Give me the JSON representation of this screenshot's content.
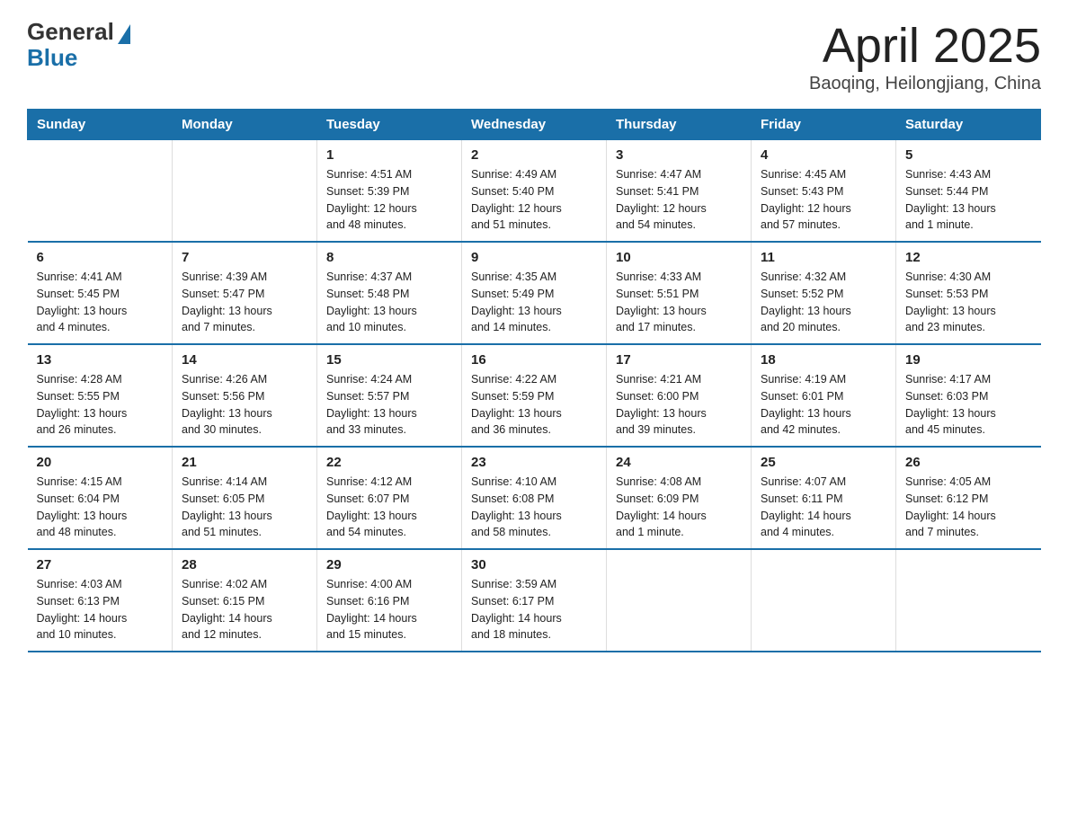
{
  "header": {
    "logo_general": "General",
    "logo_blue": "Blue",
    "title": "April 2025",
    "subtitle": "Baoqing, Heilongjiang, China"
  },
  "calendar": {
    "days_of_week": [
      "Sunday",
      "Monday",
      "Tuesday",
      "Wednesday",
      "Thursday",
      "Friday",
      "Saturday"
    ],
    "weeks": [
      [
        {
          "day": "",
          "info": ""
        },
        {
          "day": "",
          "info": ""
        },
        {
          "day": "1",
          "info": "Sunrise: 4:51 AM\nSunset: 5:39 PM\nDaylight: 12 hours\nand 48 minutes."
        },
        {
          "day": "2",
          "info": "Sunrise: 4:49 AM\nSunset: 5:40 PM\nDaylight: 12 hours\nand 51 minutes."
        },
        {
          "day": "3",
          "info": "Sunrise: 4:47 AM\nSunset: 5:41 PM\nDaylight: 12 hours\nand 54 minutes."
        },
        {
          "day": "4",
          "info": "Sunrise: 4:45 AM\nSunset: 5:43 PM\nDaylight: 12 hours\nand 57 minutes."
        },
        {
          "day": "5",
          "info": "Sunrise: 4:43 AM\nSunset: 5:44 PM\nDaylight: 13 hours\nand 1 minute."
        }
      ],
      [
        {
          "day": "6",
          "info": "Sunrise: 4:41 AM\nSunset: 5:45 PM\nDaylight: 13 hours\nand 4 minutes."
        },
        {
          "day": "7",
          "info": "Sunrise: 4:39 AM\nSunset: 5:47 PM\nDaylight: 13 hours\nand 7 minutes."
        },
        {
          "day": "8",
          "info": "Sunrise: 4:37 AM\nSunset: 5:48 PM\nDaylight: 13 hours\nand 10 minutes."
        },
        {
          "day": "9",
          "info": "Sunrise: 4:35 AM\nSunset: 5:49 PM\nDaylight: 13 hours\nand 14 minutes."
        },
        {
          "day": "10",
          "info": "Sunrise: 4:33 AM\nSunset: 5:51 PM\nDaylight: 13 hours\nand 17 minutes."
        },
        {
          "day": "11",
          "info": "Sunrise: 4:32 AM\nSunset: 5:52 PM\nDaylight: 13 hours\nand 20 minutes."
        },
        {
          "day": "12",
          "info": "Sunrise: 4:30 AM\nSunset: 5:53 PM\nDaylight: 13 hours\nand 23 minutes."
        }
      ],
      [
        {
          "day": "13",
          "info": "Sunrise: 4:28 AM\nSunset: 5:55 PM\nDaylight: 13 hours\nand 26 minutes."
        },
        {
          "day": "14",
          "info": "Sunrise: 4:26 AM\nSunset: 5:56 PM\nDaylight: 13 hours\nand 30 minutes."
        },
        {
          "day": "15",
          "info": "Sunrise: 4:24 AM\nSunset: 5:57 PM\nDaylight: 13 hours\nand 33 minutes."
        },
        {
          "day": "16",
          "info": "Sunrise: 4:22 AM\nSunset: 5:59 PM\nDaylight: 13 hours\nand 36 minutes."
        },
        {
          "day": "17",
          "info": "Sunrise: 4:21 AM\nSunset: 6:00 PM\nDaylight: 13 hours\nand 39 minutes."
        },
        {
          "day": "18",
          "info": "Sunrise: 4:19 AM\nSunset: 6:01 PM\nDaylight: 13 hours\nand 42 minutes."
        },
        {
          "day": "19",
          "info": "Sunrise: 4:17 AM\nSunset: 6:03 PM\nDaylight: 13 hours\nand 45 minutes."
        }
      ],
      [
        {
          "day": "20",
          "info": "Sunrise: 4:15 AM\nSunset: 6:04 PM\nDaylight: 13 hours\nand 48 minutes."
        },
        {
          "day": "21",
          "info": "Sunrise: 4:14 AM\nSunset: 6:05 PM\nDaylight: 13 hours\nand 51 minutes."
        },
        {
          "day": "22",
          "info": "Sunrise: 4:12 AM\nSunset: 6:07 PM\nDaylight: 13 hours\nand 54 minutes."
        },
        {
          "day": "23",
          "info": "Sunrise: 4:10 AM\nSunset: 6:08 PM\nDaylight: 13 hours\nand 58 minutes."
        },
        {
          "day": "24",
          "info": "Sunrise: 4:08 AM\nSunset: 6:09 PM\nDaylight: 14 hours\nand 1 minute."
        },
        {
          "day": "25",
          "info": "Sunrise: 4:07 AM\nSunset: 6:11 PM\nDaylight: 14 hours\nand 4 minutes."
        },
        {
          "day": "26",
          "info": "Sunrise: 4:05 AM\nSunset: 6:12 PM\nDaylight: 14 hours\nand 7 minutes."
        }
      ],
      [
        {
          "day": "27",
          "info": "Sunrise: 4:03 AM\nSunset: 6:13 PM\nDaylight: 14 hours\nand 10 minutes."
        },
        {
          "day": "28",
          "info": "Sunrise: 4:02 AM\nSunset: 6:15 PM\nDaylight: 14 hours\nand 12 minutes."
        },
        {
          "day": "29",
          "info": "Sunrise: 4:00 AM\nSunset: 6:16 PM\nDaylight: 14 hours\nand 15 minutes."
        },
        {
          "day": "30",
          "info": "Sunrise: 3:59 AM\nSunset: 6:17 PM\nDaylight: 14 hours\nand 18 minutes."
        },
        {
          "day": "",
          "info": ""
        },
        {
          "day": "",
          "info": ""
        },
        {
          "day": "",
          "info": ""
        }
      ]
    ]
  }
}
